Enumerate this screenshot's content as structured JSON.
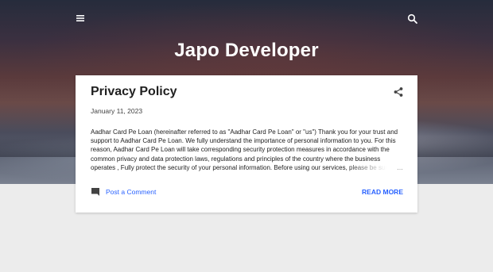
{
  "header": {
    "menu_icon": "hamburger-menu-icon",
    "search_icon": "search-icon",
    "blog_title": "Japo Developer"
  },
  "post": {
    "title": "Privacy Policy",
    "date": "January 11, 2023",
    "share_icon": "share-icon",
    "snippet": "Aadhar Card Pe Loan (hereinafter referred to as \"Aadhar Card Pe Loan\" or \"us\")   Thank you for your trust and support to Aadhar Card Pe Loan. We fully understand the importance of personal information to you. For this reason, Aadhar Card Pe Loan will take corresponding security protection measures in accordance with the common privacy and data protection laws, regulations and principles of the country where the business operates , Fully protect the security of your personal information.  Before using our services, please be sure to read and understand this policy carefully. If you st",
    "ellipsis": "…",
    "comment_icon": "comment-icon",
    "comment_label": "Post a Comment",
    "read_more_label": "READ MORE"
  },
  "colors": {
    "link": "#2962ff",
    "card_bg": "#ffffff",
    "page_bg": "#ececec"
  }
}
